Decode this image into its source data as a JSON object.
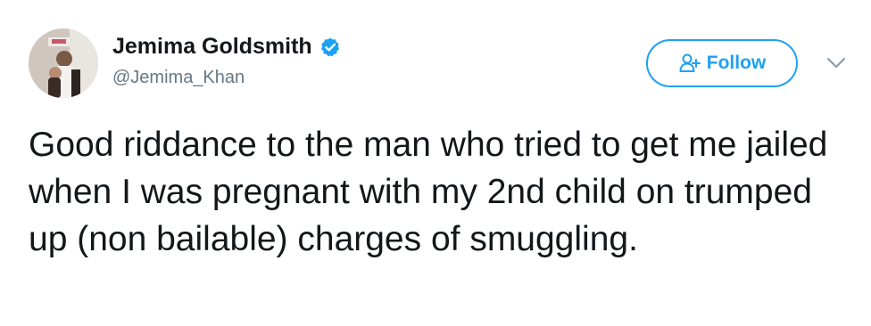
{
  "tweet": {
    "author": {
      "display_name": "Jemima Goldsmith",
      "handle": "@Jemima_Khan",
      "verified": true,
      "avatar_icon": "profile-photo"
    },
    "follow_button": {
      "label": "Follow",
      "icon": "add-user-icon"
    },
    "menu_icon": "chevron-down-icon",
    "text": "Good riddance to the man who tried to get me jailed when I was pregnant with my 2nd child on trumped up (non bailable) charges of smuggling."
  },
  "colors": {
    "accent": "#1da1f2",
    "text": "#14171a",
    "secondary_text": "#657786"
  }
}
